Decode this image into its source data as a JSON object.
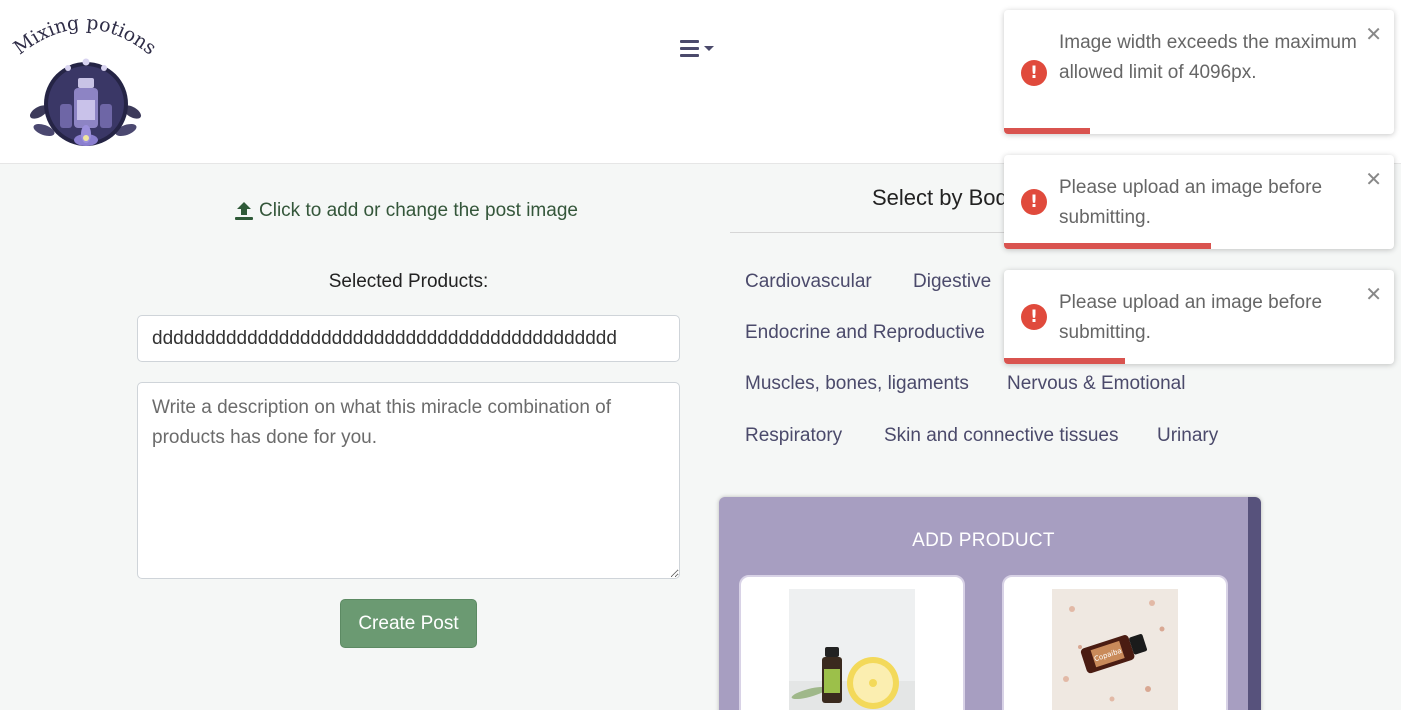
{
  "brand": {
    "name": "Mixing potions"
  },
  "nav": {
    "toggle_icon": "hamburger-menu-icon"
  },
  "upload": {
    "label": "Click to add or change the post image",
    "icon": "upload-icon"
  },
  "form": {
    "selected_label": "Selected Products:",
    "products_value": "dddddddddddddddddddddddddddddddddddddddddddd",
    "description_placeholder": "Write a description on what this miracle combination of products has done for you.",
    "submit_label": "Create Post"
  },
  "body_systems": {
    "title": "Select by Bod",
    "items": [
      "Cardiovascular",
      "Digestive",
      "Endocrine and Reproductive",
      "Muscles, bones, ligaments",
      "Nervous & Emotional",
      "Respiratory",
      "Skin and connective tissues",
      "Urinary"
    ]
  },
  "add_product": {
    "title": "ADD PRODUCT",
    "products": [
      {
        "image_alt": "Essential oil bottle beside a lemon"
      },
      {
        "image_alt": "Copaiba essential oil bottle on pink salt"
      }
    ],
    "bottle_label": "Copaiba"
  },
  "toasts": [
    {
      "message": "Image width exceeds the maximum allowed limit of 4096px.",
      "progress": 0.22,
      "icon": "error-icon"
    },
    {
      "message": "Please upload an image before submitting.",
      "progress": 0.53,
      "icon": "error-icon"
    },
    {
      "message": "Please upload an image before submitting.",
      "progress": 0.31,
      "icon": "error-icon"
    }
  ],
  "colors": {
    "accent": "#6b9a72",
    "panel": "#a79ec1",
    "error": "#d9534f"
  }
}
